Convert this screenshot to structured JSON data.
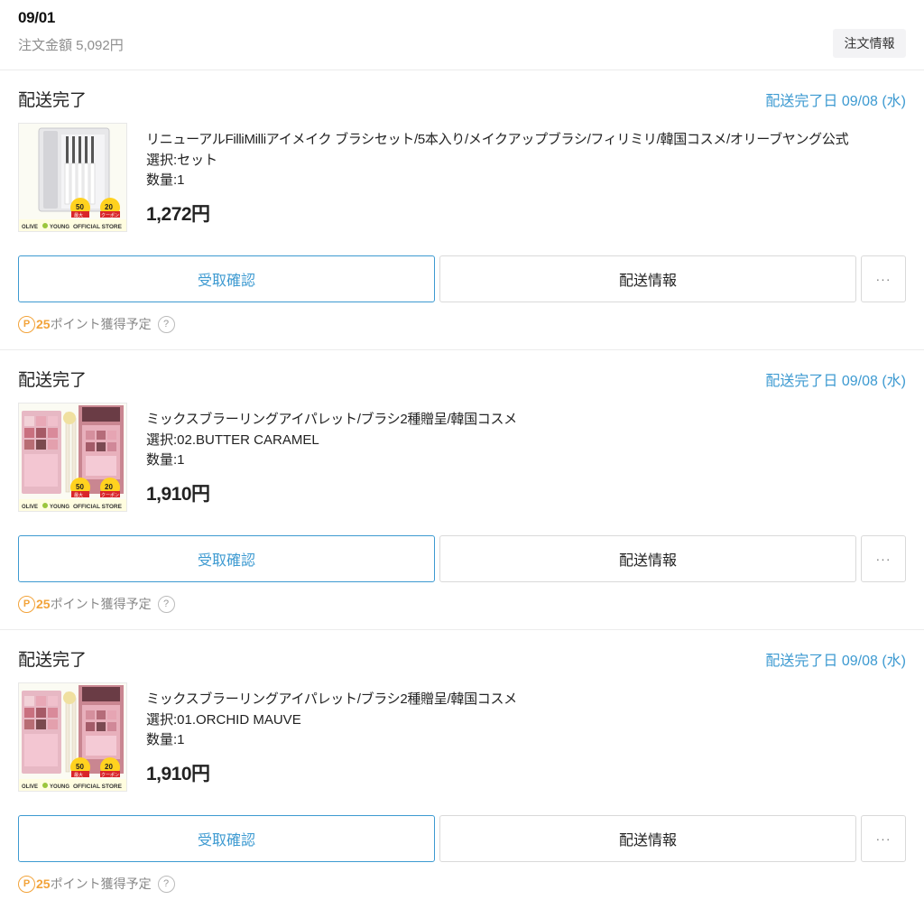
{
  "order": {
    "date": "09/01",
    "total_label": "注文金額 5,092円",
    "info_button": "注文情報"
  },
  "items": [
    {
      "status": "配送完了",
      "delivered_date": "配送完了日 09/08 (水)",
      "name": "リニューアルFilliMilliアイメイク ブラシセット/5本入り/メイクアップブラシ/フィリミリ/韓国コスメ/オリーブヤング公式",
      "option": "選択:セット",
      "qty": "数量:1",
      "price": "1,272円",
      "confirm_button": "受取確認",
      "shipping_button": "配送情報",
      "more_button": "···",
      "points_icon": "P",
      "points_count": "25",
      "points_text": "ポイント獲得予定",
      "help_icon": "?",
      "thumb": {
        "icon": "brush-set-image",
        "badge_left": "50",
        "badge_left_sub": "最大",
        "badge_right": "20",
        "badge_right_sub": "クーポン",
        "footer_brand": "OLIVE",
        "footer_brand2": "YOUNG",
        "footer_store": "OFFICIAL STORE"
      }
    },
    {
      "status": "配送完了",
      "delivered_date": "配送完了日 09/08 (水)",
      "name": "ミックスブラーリングアイパレット/ブラシ2種贈呈/韓国コスメ",
      "option": "選択:02.BUTTER CARAMEL",
      "qty": "数量:1",
      "price": "1,910円",
      "confirm_button": "受取確認",
      "shipping_button": "配送情報",
      "more_button": "···",
      "points_icon": "P",
      "points_count": "25",
      "points_text": "ポイント獲得予定",
      "help_icon": "?",
      "thumb": {
        "icon": "eye-palette-image",
        "badge_left": "50",
        "badge_left_sub": "最大",
        "badge_right": "20",
        "badge_right_sub": "クーポン",
        "footer_brand": "OLIVE",
        "footer_brand2": "YOUNG",
        "footer_store": "OFFICIAL STORE"
      }
    },
    {
      "status": "配送完了",
      "delivered_date": "配送完了日 09/08 (水)",
      "name": "ミックスブラーリングアイパレット/ブラシ2種贈呈/韓国コスメ",
      "option": "選択:01.ORCHID MAUVE",
      "qty": "数量:1",
      "price": "1,910円",
      "confirm_button": "受取確認",
      "shipping_button": "配送情報",
      "more_button": "···",
      "points_icon": "P",
      "points_count": "25",
      "points_text": "ポイント獲得予定",
      "help_icon": "?",
      "thumb": {
        "icon": "eye-palette-image",
        "badge_left": "50",
        "badge_left_sub": "最大",
        "badge_right": "20",
        "badge_right_sub": "クーポン",
        "footer_brand": "OLIVE",
        "footer_brand2": "YOUNG",
        "footer_store": "OFFICIAL STORE"
      }
    }
  ],
  "colors": {
    "accent": "#3d9ad1",
    "points": "#f2a33a",
    "badge_red": "#d9252a",
    "badge_yellow": "#ffd21f"
  }
}
